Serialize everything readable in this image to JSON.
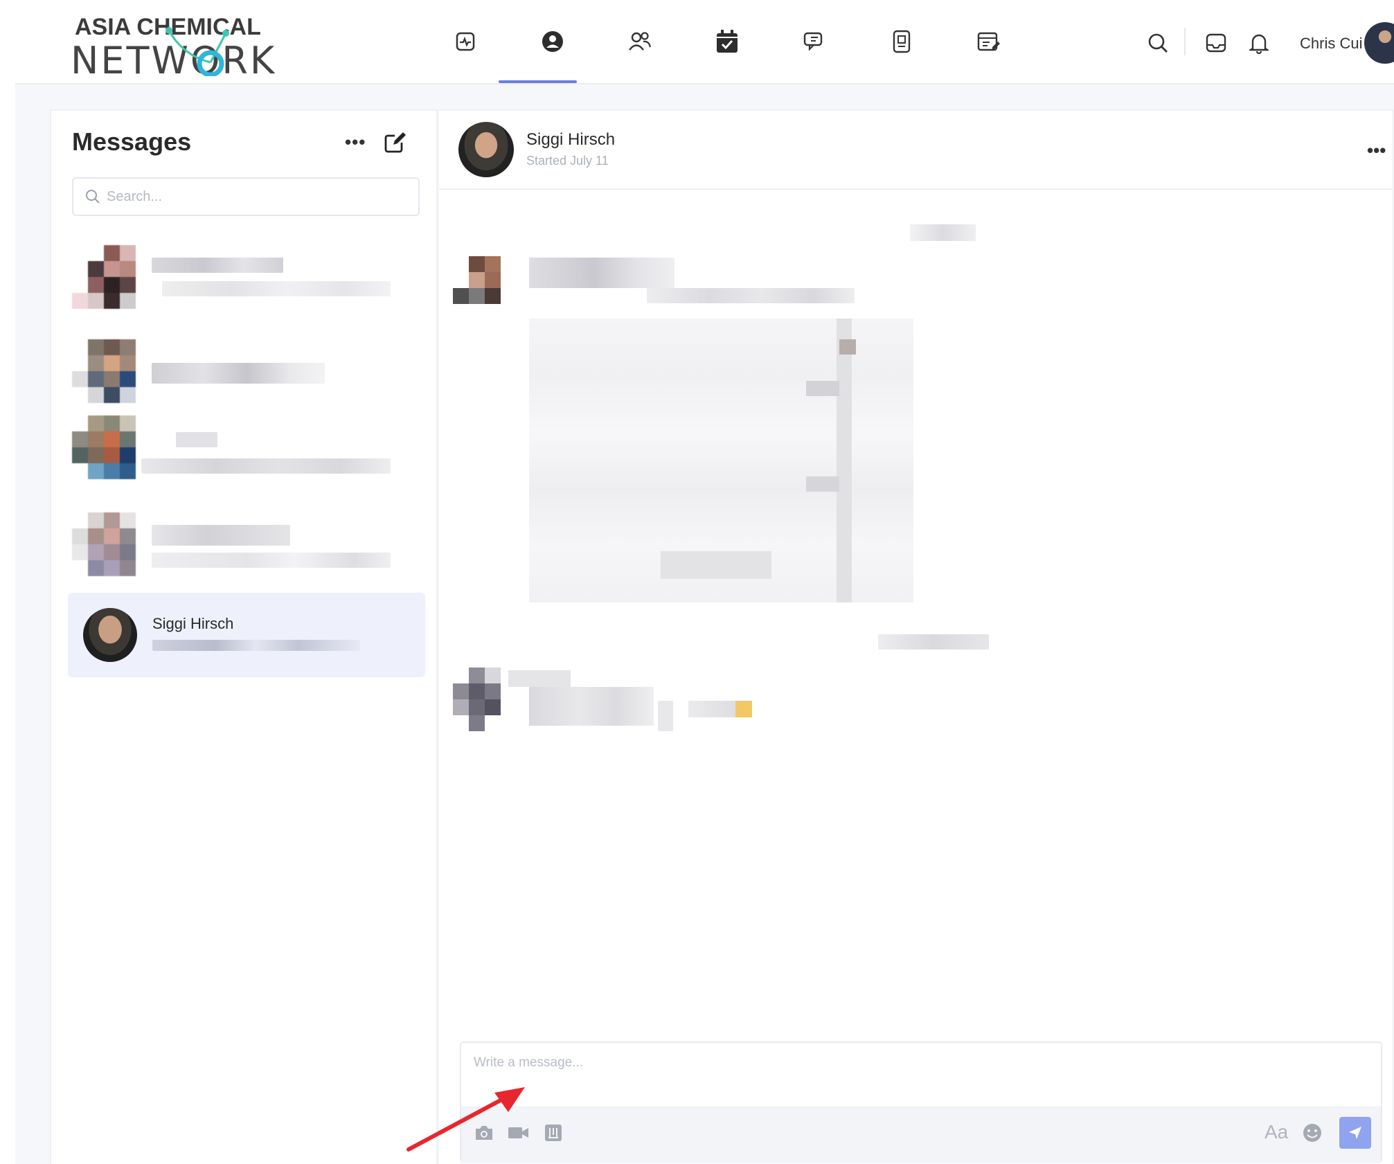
{
  "brand": {
    "line1": "ASIA CHEMICAL",
    "line2": "NETWORK"
  },
  "nav": {
    "icons": [
      "activity-icon",
      "profile-icon",
      "people-icon",
      "calendar-check-icon",
      "chat-bubbles-icon",
      "document-icon",
      "notepad-icon"
    ],
    "active_index": 1
  },
  "header_right": {
    "user_name": "Chris Cui",
    "icons": [
      "search-icon",
      "inbox-icon",
      "bell-icon"
    ]
  },
  "messages_panel": {
    "title": "Messages",
    "more_label": "•••",
    "search_placeholder": "Search...",
    "active_conversation": {
      "name": "Siggi Hirsch"
    }
  },
  "chat": {
    "contact_name": "Siggi Hirsch",
    "subtitle": "Started July 11",
    "more_label": "•••",
    "composer_placeholder": "Write a message...",
    "text_format_label": "Aa"
  },
  "colors": {
    "accent": "#6b7fdc",
    "send_button": "#8fa3ee",
    "active_row": "#eef0fc",
    "annotation_arrow": "#e8262d"
  }
}
